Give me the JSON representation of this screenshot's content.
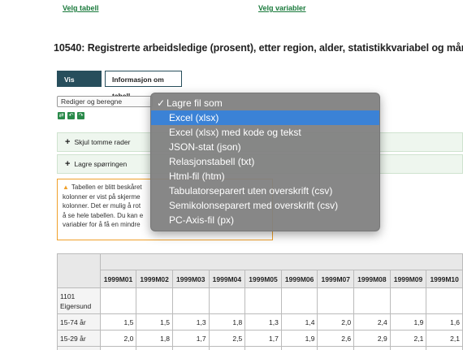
{
  "links": {
    "select_table": "Velg tabell",
    "select_variables": "Velg variabler"
  },
  "title": "10540: Registrerte arbeidsledige (prosent), etter region, alder, statistikkvariabel og måned",
  "tabs": [
    {
      "label": "Vis tabell"
    },
    {
      "label": "Informasjon om tabell"
    }
  ],
  "select": {
    "value": "Rediger og beregne"
  },
  "panels": {
    "hide_empty_rows": "Skjul tomme rader",
    "save_queries": "Lagre spørringen"
  },
  "warning_lines": [
    "Tabellen er blitt beskåret",
    "kolonner er vist på skjerme",
    "kolonner. Det er mulig å rot",
    "å se hele tabellen. Du kan e",
    "variabler for å få en mindre"
  ],
  "menu": {
    "header": "Lagre fil som",
    "check_glyph": "✓",
    "items": [
      "Excel (xlsx)",
      "Excel (xlsx) med kode og tekst",
      "JSON-stat (json)",
      "Relasjonstabell (txt)",
      "Html-fil (htm)",
      "Tabulatorseparert uten overskrift (csv)",
      "Semikolonseparert med overskrift (csv)",
      "PC-Axis-fil (px)"
    ],
    "selected_index": 0
  },
  "table": {
    "months": [
      "1999M01",
      "1999M02",
      "1999M03",
      "1999M04",
      "1999M05",
      "1999M06",
      "1999M07",
      "1999M08",
      "1999M09",
      "1999M10"
    ],
    "region": "1101 Eigersund",
    "rows": [
      {
        "label": "15-74 år",
        "values": [
          "1,5",
          "1,5",
          "1,3",
          "1,8",
          "1,3",
          "1,4",
          "2,0",
          "2,4",
          "1,9",
          "1,6"
        ]
      },
      {
        "label": "15-29 år",
        "values": [
          "2,0",
          "1,8",
          "1,7",
          "2,5",
          "1,7",
          "1,9",
          "2,6",
          "2,9",
          "2,1",
          "2,1"
        ]
      }
    ]
  }
}
